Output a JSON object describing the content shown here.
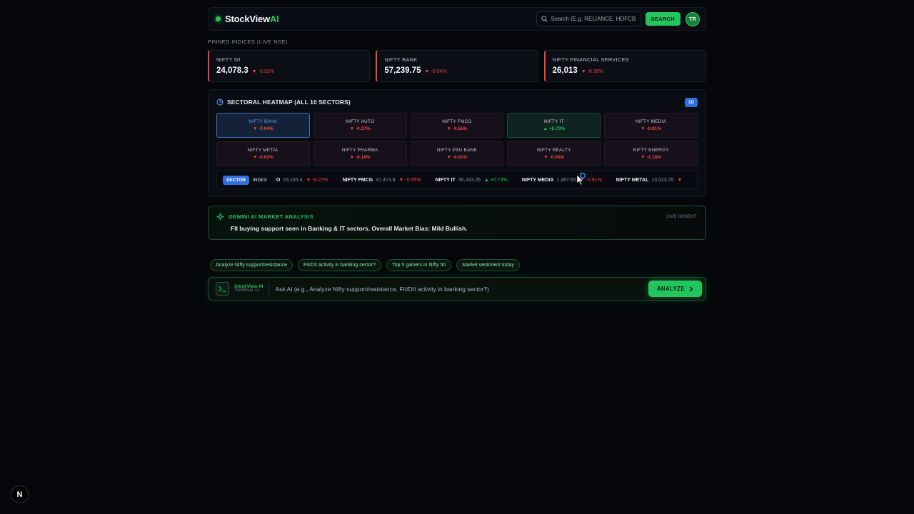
{
  "header": {
    "brand_main": "StockView",
    "brand_accent": "AI",
    "search_placeholder": "Search (E.g. RELIANCE, HDFCBANK)",
    "search_button": "SEARCH",
    "avatar_initials": "TR"
  },
  "pinned": {
    "label": "PINNED INDICES (LIVE NSE)",
    "cards": [
      {
        "name": "NIFTY 50",
        "value": "24,078.3",
        "change": "▼ -0.32%"
      },
      {
        "name": "NIFTY BANK",
        "value": "57,239.75",
        "change": "▼ -0.04%"
      },
      {
        "name": "NIFTY FINANCIAL SERVICES",
        "value": "26,013",
        "change": "▼ -0.36%"
      }
    ]
  },
  "heatmap": {
    "title": "SECTORAL HEATMAP (ALL 10 SECTORS)",
    "badge": "1D",
    "tiles": [
      {
        "name": "NIFTY BANK",
        "change": "▼ -0.04%",
        "state": "active"
      },
      {
        "name": "NIFTY AUTO",
        "change": "▼ -0.27%",
        "state": "down"
      },
      {
        "name": "NIFTY FMCG",
        "change": "▼ -0.55%",
        "state": "down"
      },
      {
        "name": "NIFTY IT",
        "change": "▲ +0.73%",
        "state": "up"
      },
      {
        "name": "NIFTY MEDIA",
        "change": "▼ -0.91%",
        "state": "down"
      },
      {
        "name": "NIFTY METAL",
        "change": "▼ -0.02%",
        "state": "down"
      },
      {
        "name": "NIFTY PHARMA",
        "change": "▼ -0.18%",
        "state": "down"
      },
      {
        "name": "NIFTY PSU BANK",
        "change": "▼ -0.01%",
        "state": "down"
      },
      {
        "name": "NIFTY REALTY",
        "change": "▼ -0.05%",
        "state": "down"
      },
      {
        "name": "NIFTY ENERGY",
        "change": "▼ -1.18%",
        "state": "down"
      }
    ]
  },
  "ticker": {
    "toggle_sector": "SECTOR",
    "toggle_index": "INDEX",
    "items": [
      {
        "name": "O",
        "value": "29,185.4",
        "change": "▼ -0.27%",
        "dir": "down"
      },
      {
        "name": "NIFTY FMCG",
        "value": "47,473.9",
        "change": "▼ -0.55%",
        "dir": "down"
      },
      {
        "name": "NIFTY IT",
        "value": "30,433.05",
        "change": "▲ +0.73%",
        "dir": "up"
      },
      {
        "name": "NIFTY MEDIA",
        "value": "1,387.65",
        "change": "▼ -0.91%",
        "dir": "down"
      },
      {
        "name": "NIFTY METAL",
        "value": "13,023.25",
        "change": "▼",
        "dir": "down"
      }
    ]
  },
  "analysis": {
    "title": "GEMINI AI MARKET ANALYSIS",
    "live": "LIVE INSIGHT",
    "text": "FII buying support seen in Banking & IT sectors. Overall Market Bias: Mild Bullish."
  },
  "chips": [
    "Analyze Nifty support/resistance",
    "FII/DII activity in banking sector?",
    "Top 5 gainers in Nifty 50",
    "Market sentiment today"
  ],
  "terminal": {
    "brand": "StockView AI",
    "version": "TERMINAL v2",
    "placeholder": "Ask AI (e.g., Analyze Nifty support/resistance, FII/DII activity in banking sector?)",
    "button": "ANALYZE"
  },
  "next_badge": "N",
  "colors": {
    "accent": "#22c55e",
    "down": "#ef4444",
    "selected": "#2f6fe0"
  }
}
